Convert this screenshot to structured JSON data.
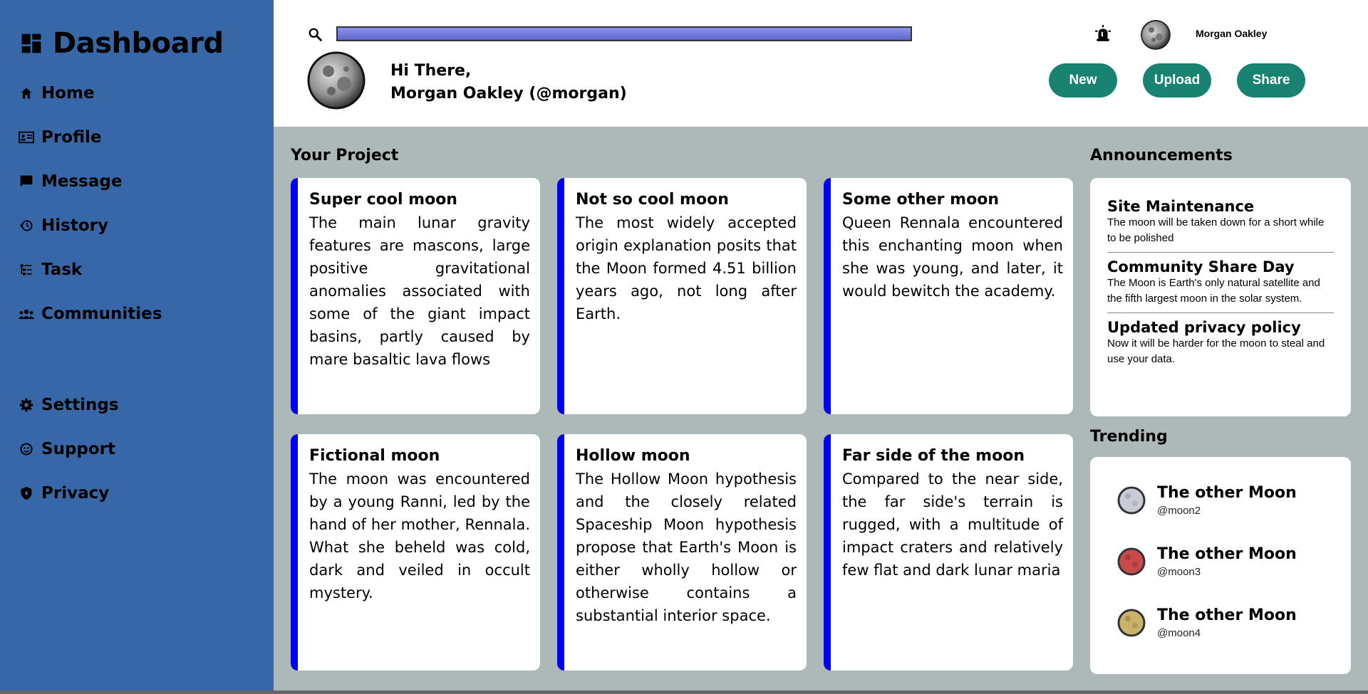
{
  "sidebar": {
    "brand": "Dashboard",
    "nav": [
      {
        "label": "Home",
        "icon": "home-icon"
      },
      {
        "label": "Profile",
        "icon": "id-card-icon"
      },
      {
        "label": "Message",
        "icon": "message-icon"
      },
      {
        "label": "History",
        "icon": "history-icon"
      },
      {
        "label": "Task",
        "icon": "task-icon"
      },
      {
        "label": "Communities",
        "icon": "people-icon"
      }
    ],
    "nav_bottom": [
      {
        "label": "Settings",
        "icon": "gear-icon"
      },
      {
        "label": "Support",
        "icon": "support-icon"
      },
      {
        "label": "Privacy",
        "icon": "shield-icon"
      }
    ]
  },
  "header": {
    "search_value": "",
    "user_name": "Morgan Oakley",
    "greeting_line1": "Hi There,",
    "greeting_line2": "Morgan Oakley (@morgan)",
    "buttons": {
      "new": "New",
      "upload": "Upload",
      "share": "Share"
    }
  },
  "projects": {
    "title": "Your Project",
    "cards": [
      {
        "title": "Super cool moon",
        "body": "The main lunar gravity features are mascons, large positive gravitational anomalies associated with some of the giant impact basins, partly caused by mare basaltic lava flows"
      },
      {
        "title": "Not so cool moon",
        "body": "The most widely accepted origin explanation posits that the Moon formed 4.51 billion years ago, not long after Earth."
      },
      {
        "title": "Some other moon",
        "body": "Queen Rennala encountered this enchanting moon when she was young, and later, it would bewitch the academy."
      },
      {
        "title": "Fictional moon",
        "body": "The moon was encountered by a young Ranni, led by the hand of her mother, Rennala. What she beheld was cold, dark and veiled in occult mystery."
      },
      {
        "title": "Hollow moon",
        "body": "The Hollow Moon hypothesis and the closely related Spaceship Moon hypothesis propose that Earth's Moon is either wholly hollow or otherwise contains a substantial interior space."
      },
      {
        "title": "Far side of the moon",
        "body": "Compared to the near side, the far side's terrain is rugged, with a multitude of impact craters and relatively few flat and dark lunar maria"
      }
    ]
  },
  "announcements": {
    "title": "Announcements",
    "items": [
      {
        "title": "Site Maintenance",
        "body": "The moon will be taken down for a short while to be polished"
      },
      {
        "title": "Community Share Day",
        "body": "The Moon is Earth's only natural satellite and the fifth largest moon in the solar system."
      },
      {
        "title": "Updated privacy policy",
        "body": "Now it will be harder for the moon to steal and use your data."
      }
    ]
  },
  "trending": {
    "title": "Trending",
    "items": [
      {
        "name": "The other Moon",
        "handle": "@moon2",
        "color": "#c9ccd6"
      },
      {
        "name": "The other Moon",
        "handle": "@moon3",
        "color": "#c94a4a"
      },
      {
        "name": "The other Moon",
        "handle": "@moon4",
        "color": "#c9b36a"
      }
    ]
  },
  "colors": {
    "sidebar": "#3867a7",
    "main_bg": "#adb8b8",
    "accent_button": "#1a8270",
    "card_border": "#0000ee"
  }
}
